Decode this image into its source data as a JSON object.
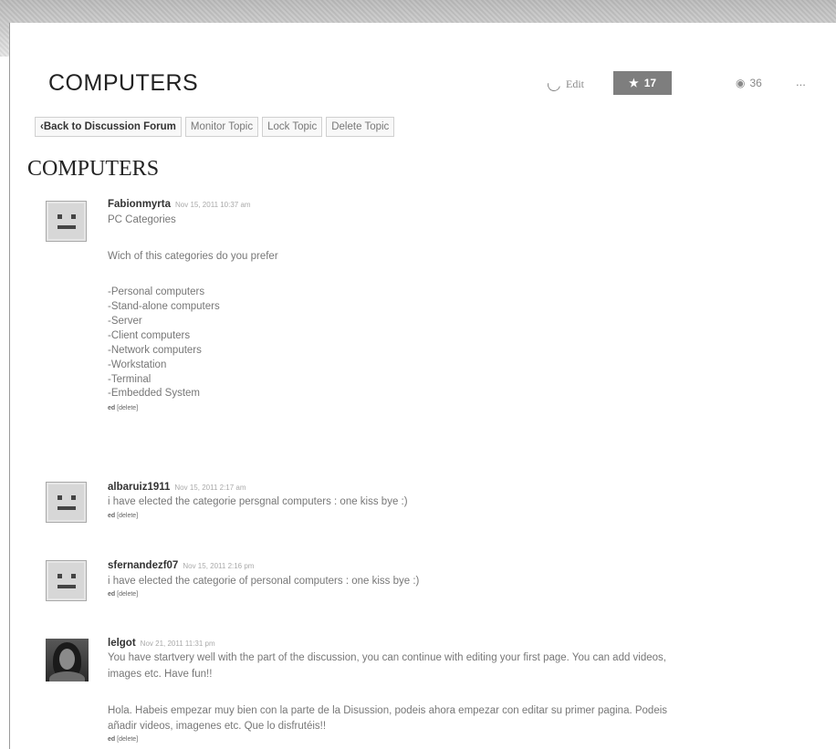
{
  "header": {
    "title": "COMPUTERS",
    "edit_label": "Edit",
    "follow_count": "17",
    "views_count": "36",
    "more_label": "..."
  },
  "toolbar": {
    "back_label": "‹Back to Discussion Forum",
    "monitor_label": "Monitor Topic",
    "lock_label": "Lock Topic",
    "delete_label": "Delete Topic"
  },
  "topic": {
    "title": "COMPUTERS"
  },
  "posts": [
    {
      "author": "Fabionmyrta",
      "timestamp": "Nov 15, 2011 10:37 am",
      "lines": [
        "PC Categories",
        "Wich of this categories do you prefer",
        "-Personal computers",
        "-Stand-alone computers",
        "-Server",
        "-Client computers",
        "-Network computers",
        "-Workstation",
        "-Terminal",
        "-Embedded System"
      ],
      "edit_label": "ed",
      "delete_label": "[delete]"
    },
    {
      "author": "albaruiz1911",
      "timestamp": "Nov 15, 2011 2:17 am",
      "lines": [
        "i have elected the categorie persgnal computers : one kiss bye :)"
      ],
      "edit_label": "ed",
      "delete_label": "[delete]"
    },
    {
      "author": "sfernandezf07",
      "timestamp": "Nov 15, 2011 2:16 pm",
      "lines": [
        "i have elected the categorie of personal computers : one kiss bye :)"
      ],
      "edit_label": "ed",
      "delete_label": "[delete]"
    },
    {
      "author": "lelgot",
      "timestamp": "Nov 21, 2011 11:31 pm",
      "lines": [
        "You have startvery well with the part of the discussion, you can continue with editing your first page. You can add videos,",
        "images etc. Have fun!!",
        "Hola. Habeis empezar muy bien con la parte de la Disussion, podeis ahora empezar con editar su primer pagina. Podeis",
        "añadir videos, imagenes etc. Que lo disfrutéis!!"
      ],
      "edit_label": "ed",
      "delete_label": "[delete]"
    }
  ]
}
